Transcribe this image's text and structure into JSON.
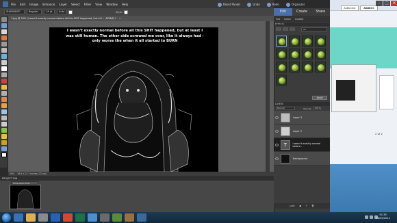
{
  "menu": {
    "items": [
      "File",
      "Edit",
      "Image",
      "Enhance",
      "Layer",
      "Select",
      "Filter",
      "View",
      "Window",
      "Help"
    ],
    "right_buttons": [
      "Reset Panels",
      "Undo",
      "Redo",
      "Organizer"
    ]
  },
  "options": {
    "font_name": "SHAMANCE",
    "font_style": "Regular",
    "font_size": "14 pt",
    "leading_label": "Auto",
    "style_label": "Style:"
  },
  "document": {
    "tab_title": "1.jpg @ 50% (I wasn't exactly normal before all this SHIT happened, but at l... ,RGB/8) *",
    "story_text": "I wasn't exactly normal before all this SHIT happened, but at least I was still human. The other side screwed me over, like it always had - only worse the when it all started to BURN",
    "zoom": "50%",
    "dimensions": "16.9 x 21.1 inches (72 ppi)"
  },
  "project_bin": {
    "label": "PROJECT BIN",
    "select_value": "Show Open Files"
  },
  "panel": {
    "tabs": [
      "Edit",
      "Create",
      "Share"
    ],
    "active_tab": "Edit",
    "subtabs": [
      "Full",
      "Quick",
      "Guided"
    ],
    "effects_header": "EFFECTS",
    "effects_dropdown": "All",
    "apply_label": "Apply",
    "layers_header": "LAYERS",
    "blend_mode": "Normal",
    "opacity_label": "Opacity:",
    "opacity_value": "100%",
    "layers": [
      {
        "name": "Layer 3"
      },
      {
        "name": "Layer 2"
      },
      {
        "name": "I wasn't exactly normal before..."
      },
      {
        "name": "Background"
      }
    ],
    "footer": [
      "Lock:"
    ]
  },
  "background_window": {
    "style1": "AaBbCcDc",
    "style2": "AABBCC",
    "page_info": "2 of 2"
  },
  "taskbar": {
    "time": "01:35",
    "date": "18/02/2012"
  },
  "colors": {
    "accent": "#4b6fa8",
    "panel": "#3c3c3c",
    "canvas_bg": "#5e5e5e"
  }
}
